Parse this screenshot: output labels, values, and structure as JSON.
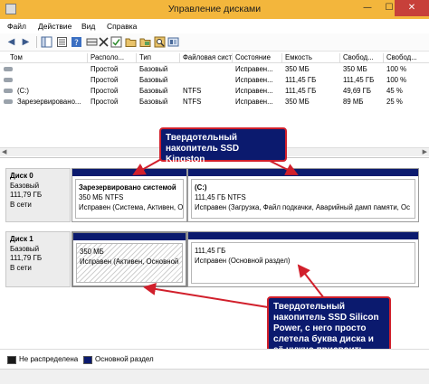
{
  "window": {
    "title": "Управление дисками",
    "btn_min": "—",
    "btn_max": "☐",
    "btn_close": "✕"
  },
  "menu": [
    "Файл",
    "Действие",
    "Вид",
    "Справка"
  ],
  "toolbar": {
    "back_glyph": "◀",
    "forward_glyph": "▶"
  },
  "volume_table": {
    "headers": [
      "Том",
      "Располо...",
      "Тип",
      "Файловая система",
      "Состояние",
      "Емкость",
      "Свобод...",
      "Свобод..."
    ],
    "rows": [
      [
        "",
        "Простой",
        "Базовый",
        "",
        "Исправен...",
        "350 МБ",
        "350 МБ",
        "100 %"
      ],
      [
        "",
        "Простой",
        "Базовый",
        "",
        "Исправен...",
        "111,45 ГБ",
        "111,45 ГБ",
        "100 %"
      ],
      [
        "(C:)",
        "Простой",
        "Базовый",
        "NTFS",
        "Исправен...",
        "111,45 ГБ",
        "49,69 ГБ",
        "45 %"
      ],
      [
        "Зарезервировано...",
        "Простой",
        "Базовый",
        "NTFS",
        "Исправен...",
        "350 МБ",
        "89 МБ",
        "25 %"
      ]
    ]
  },
  "scroll": {
    "left": "◀",
    "right": "▶"
  },
  "disks": [
    {
      "name": "Диск 0",
      "type": "Базовый",
      "size": "111,79 ГБ",
      "status": "В сети",
      "partitions": [
        {
          "name": "Зарезервировано системой",
          "size_fs": "350 МБ NTFS",
          "status": "Исправен (Система, Активен, О"
        },
        {
          "name": "(C:)",
          "size_fs": "111,45 ГБ NTFS",
          "status": "Исправен (Загрузка, Файл подкачки, Аварийный дамп памяти, Ос"
        }
      ]
    },
    {
      "name": "Диск 1",
      "type": "Базовый",
      "size": "111,79 ГБ",
      "status": "В сети",
      "partitions": [
        {
          "name": "",
          "size_fs": "350 МБ",
          "status": "Исправен (Активен, Основной"
        },
        {
          "name": "",
          "size_fs": "111,45 ГБ",
          "status": "Исправен (Основной раздел)"
        }
      ]
    }
  ],
  "callouts": {
    "kingston": "Твердотельный накопитель SSD Kingston",
    "silicon": "Твердотельный накопитель SSD Silicon Power, с него просто слетела буква диска и её нужно присвоить."
  },
  "legend": {
    "unallocated": "Не распределена",
    "primary": "Основной раздел"
  },
  "colors": {
    "titlebar": "#f3b63c",
    "partition_bar": "#0b1a6e",
    "callout_bg": "#0b1a6e",
    "callout_border": "#d11f2b",
    "arrow": "#d11f2b"
  }
}
